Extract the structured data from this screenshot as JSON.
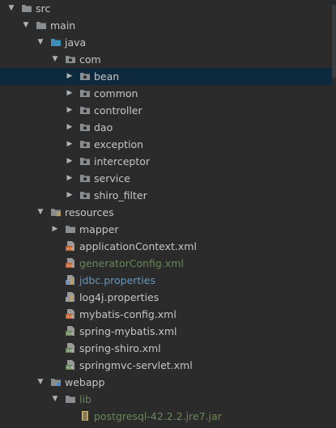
{
  "tree": [
    {
      "label": "src",
      "level": 0,
      "expanded": true,
      "icon": "folder-icon",
      "iconColor": "#8a8d90",
      "textColor": "#c6c6c6"
    },
    {
      "label": "main",
      "level": 1,
      "expanded": true,
      "icon": "folder-icon",
      "iconColor": "#8a8d90",
      "textColor": "#c6c6c6"
    },
    {
      "label": "java",
      "level": 2,
      "expanded": true,
      "icon": "source-folder-icon",
      "iconColor": "#3d8fb8",
      "textColor": "#c6c6c6"
    },
    {
      "label": "com",
      "level": 3,
      "expanded": true,
      "icon": "package-icon",
      "iconColor": "#8a8d90",
      "textColor": "#c6c6c6"
    },
    {
      "label": "bean",
      "level": 4,
      "expanded": false,
      "icon": "package-icon",
      "iconColor": "#8a8d90",
      "textColor": "#c6c6c6",
      "selected": true
    },
    {
      "label": "common",
      "level": 4,
      "expanded": false,
      "icon": "package-icon",
      "iconColor": "#8a8d90",
      "textColor": "#c6c6c6"
    },
    {
      "label": "controller",
      "level": 4,
      "expanded": false,
      "icon": "package-icon",
      "iconColor": "#8a8d90",
      "textColor": "#c6c6c6"
    },
    {
      "label": "dao",
      "level": 4,
      "expanded": false,
      "icon": "package-icon",
      "iconColor": "#8a8d90",
      "textColor": "#c6c6c6"
    },
    {
      "label": "exception",
      "level": 4,
      "expanded": false,
      "icon": "package-icon",
      "iconColor": "#8a8d90",
      "textColor": "#c6c6c6"
    },
    {
      "label": "interceptor",
      "level": 4,
      "expanded": false,
      "icon": "package-icon",
      "iconColor": "#8a8d90",
      "textColor": "#c6c6c6"
    },
    {
      "label": "service",
      "level": 4,
      "expanded": false,
      "icon": "package-icon",
      "iconColor": "#8a8d90",
      "textColor": "#c6c6c6"
    },
    {
      "label": "shiro_filter",
      "level": 4,
      "expanded": false,
      "icon": "package-icon",
      "iconColor": "#8a8d90",
      "textColor": "#c6c6c6"
    },
    {
      "label": "resources",
      "level": 2,
      "expanded": true,
      "icon": "resources-folder-icon",
      "iconColor": "#8a8d90",
      "textColor": "#c6c6c6"
    },
    {
      "label": "mapper",
      "level": 3,
      "expanded": false,
      "icon": "folder-icon",
      "iconColor": "#8a8d90",
      "textColor": "#c6c6c6"
    },
    {
      "label": "applicationContext.xml",
      "level": 3,
      "leaf": true,
      "icon": "xml-file-icon",
      "iconColor": "#c5602c",
      "textColor": "#c6c6c6"
    },
    {
      "label": "generatorConfig.xml",
      "level": 3,
      "leaf": true,
      "icon": "xml-file-icon",
      "iconColor": "#c5602c",
      "textColor": "#6a8759"
    },
    {
      "label": "jdbc.properties",
      "level": 3,
      "leaf": true,
      "icon": "properties-file-icon",
      "iconColor": "#6a8fb5",
      "textColor": "#6897bb"
    },
    {
      "label": "log4j.properties",
      "level": 3,
      "leaf": true,
      "icon": "properties-file-icon",
      "iconColor": "#9a9a9a",
      "textColor": "#c6c6c6"
    },
    {
      "label": "mybatis-config.xml",
      "level": 3,
      "leaf": true,
      "icon": "xml-file-icon",
      "iconColor": "#c5602c",
      "textColor": "#c6c6c6"
    },
    {
      "label": "spring-mybatis.xml",
      "level": 3,
      "leaf": true,
      "icon": "spring-xml-file-icon",
      "iconColor": "#6a8759",
      "textColor": "#c6c6c6"
    },
    {
      "label": "spring-shiro.xml",
      "level": 3,
      "leaf": true,
      "icon": "spring-xml-file-icon",
      "iconColor": "#6a8759",
      "textColor": "#c6c6c6"
    },
    {
      "label": "springmvc-servlet.xml",
      "level": 3,
      "leaf": true,
      "icon": "spring-xml-file-icon",
      "iconColor": "#6a8759",
      "textColor": "#c6c6c6"
    },
    {
      "label": "webapp",
      "level": 2,
      "expanded": true,
      "icon": "web-folder-icon",
      "iconColor": "#8a8d90",
      "textColor": "#c6c6c6"
    },
    {
      "label": "lib",
      "level": 3,
      "expanded": true,
      "icon": "folder-icon",
      "iconColor": "#8a8d90",
      "textColor": "#6a8759"
    },
    {
      "label": "postgresql-42.2.2.jre7.jar",
      "level": 4,
      "leaf": true,
      "icon": "jar-file-icon",
      "iconColor": "#b9a86b",
      "textColor": "#6a8759"
    }
  ]
}
